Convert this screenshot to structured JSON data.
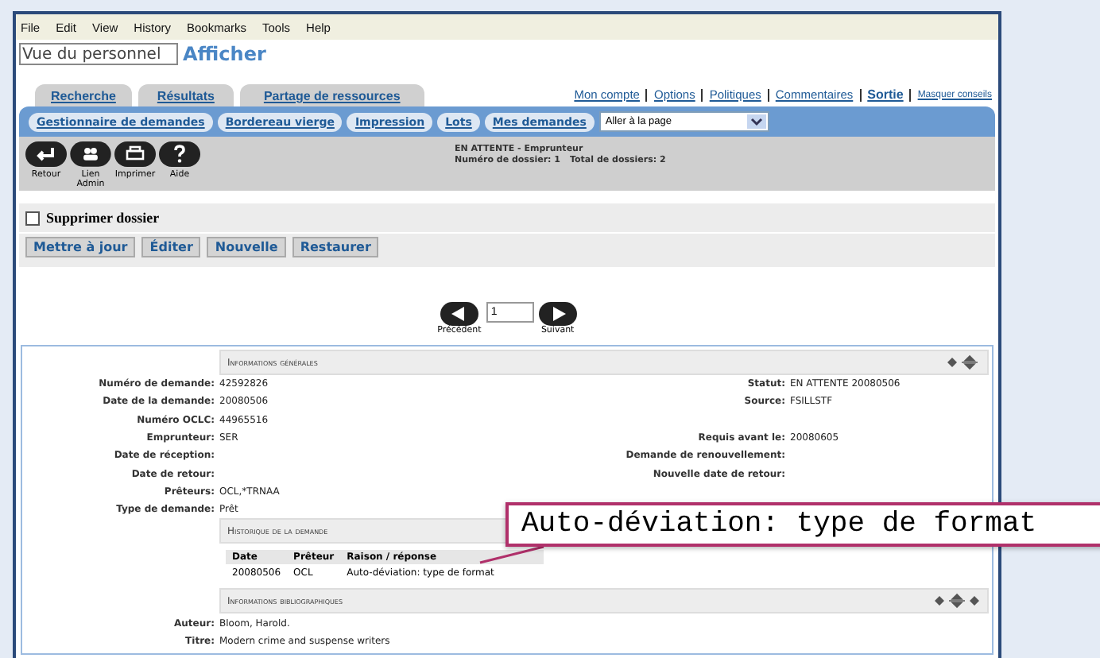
{
  "menu": [
    "File",
    "Edit",
    "View",
    "History",
    "Bookmarks",
    "Tools",
    "Help"
  ],
  "view_field": {
    "value": "Vue du personnel"
  },
  "view_title": "Afficher",
  "tabs": [
    {
      "label": "Recherche",
      "selected": false
    },
    {
      "label": "Résultats",
      "selected": false
    },
    {
      "label": "Partage de ressources",
      "selected": false
    }
  ],
  "top_links": [
    {
      "label": "Mon compte",
      "kind": "link"
    },
    {
      "label": "Options",
      "kind": "link"
    },
    {
      "label": "Politiques",
      "kind": "link"
    },
    {
      "label": "Commentaires",
      "kind": "link"
    },
    {
      "label": "Sortie",
      "kind": "strong"
    },
    {
      "label": "Masquer conseils",
      "kind": "small"
    }
  ],
  "nav_buttons": [
    "Gestionnaire de demandes",
    "Bordereau vierge",
    "Impression",
    "Lots",
    "Mes demandes"
  ],
  "page_select": {
    "value": "Aller à la page"
  },
  "toolbar": [
    {
      "label": "Retour",
      "kind": "return"
    },
    {
      "label": "Lien Admin",
      "kind": "people"
    },
    {
      "label": "Imprimer",
      "kind": "print"
    },
    {
      "label": "Aide",
      "kind": "help"
    }
  ],
  "status": {
    "title": "EN ATTENTE - Emprunteur",
    "record": "Numéro de dossier: 1",
    "total": "Total de dossiers: 2"
  },
  "delete_checkbox": {
    "label": "Supprimer dossier",
    "checked": false
  },
  "actions": [
    "Mettre à jour",
    "Éditer",
    "Nouvelle",
    "Restaurer"
  ],
  "pager": {
    "previous": "Précédent",
    "page": "1",
    "next": "Suivant"
  },
  "general": {
    "title": "Informations générales",
    "rows": [
      {
        "label": "Numéro de demande:",
        "value": "42592826",
        "right_label": "Statut:",
        "right_value": "EN ATTENTE 20080506"
      },
      {
        "label": "Date de la demande:",
        "value": "20080506",
        "right_label": "Source:",
        "right_value": "FSILLSTF"
      },
      {
        "label": "Numéro OCLC:",
        "value": "44965516"
      },
      {
        "label": "Emprunteur:",
        "value": "SER",
        "right_label": "Requis avant le:",
        "right_value": "20080605"
      },
      {
        "label": "Date de réception:",
        "right_label": "Demande de renouvellement:"
      },
      {
        "label": "Date de retour:",
        "right_label": "Nouvelle date de retour:"
      },
      {
        "label": "Prêteurs:",
        "value": "OCL,*TRNAA"
      },
      {
        "label": "Type de demande:",
        "value": "Prêt"
      }
    ]
  },
  "history": {
    "title": "Historique de la demande",
    "columns": [
      "Date",
      "Prêteur",
      "Raison / réponse"
    ],
    "rows": [
      [
        "20080506",
        "OCL",
        "Auto-déviation: type de format"
      ]
    ]
  },
  "biblio": {
    "title": "Informations bibliographiques",
    "rows": [
      {
        "label": "Auteur:",
        "value": "Bloom, Harold."
      },
      {
        "label": "Titre:",
        "value": "Modern crime and suspense writers"
      }
    ]
  },
  "callout": "Auto-déviation: type de format"
}
